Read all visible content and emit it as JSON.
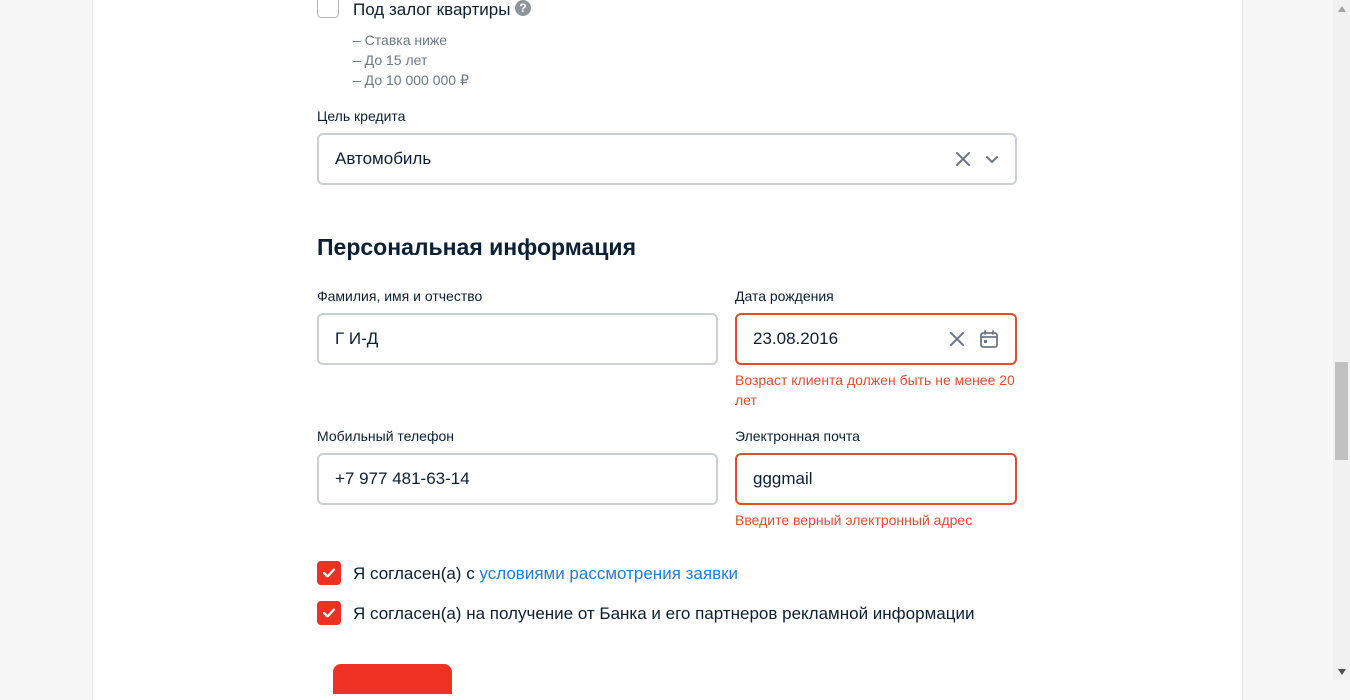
{
  "pledge": {
    "label": "Под залог квартиры",
    "help": "?",
    "benefits": [
      "– Ставка ниже",
      "– До 15 лет",
      "– До 10 000 000 ₽"
    ]
  },
  "purpose": {
    "label": "Цель кредита",
    "value": "Автомобиль"
  },
  "personal": {
    "title": "Персональная информация",
    "name_label": "Фамилия, имя и отчество",
    "name_value": "Г И-Д",
    "dob_label": "Дата рождения",
    "dob_value": "23.08.2016",
    "dob_error_line1": "Возраст клиента должен быть не менее 20",
    "dob_error_line2": "лет",
    "phone_label": "Мобильный телефон",
    "phone_value": "+7 977 481-63-14",
    "email_label": "Электронная почта",
    "email_value": "gggmail",
    "email_error": "Введите верный электронный адрес"
  },
  "consents": {
    "terms_prefix": "Я согласен(а) с ",
    "terms_link": "условиями рассмотрения заявки",
    "terms_checked": true,
    "ads_text": "Я согласен(а) на получение от Банка и его партнеров рекламной информации",
    "ads_checked": true
  },
  "colors": {
    "accent": "#ef3124",
    "error": "#e04e2e",
    "link": "#1f7fd6"
  }
}
